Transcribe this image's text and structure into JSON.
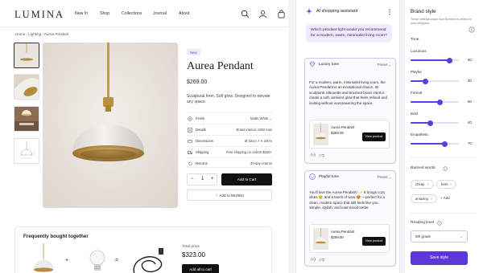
{
  "store": {
    "logo": "LUMINA",
    "nav": [
      "New In",
      "Shop",
      "Collections",
      "Journal",
      "About"
    ],
    "breadcrumb": [
      "Home",
      "Lighting",
      "Aurea Pendant"
    ],
    "badge": "New",
    "product": {
      "title": "Aurea Pendant",
      "price": "$269.00",
      "description": "Sculptural form. Soft glow. Designed to elevate any space."
    },
    "specs": [
      {
        "icon": "finish-icon",
        "label": "Finish",
        "value": "Matte White"
      },
      {
        "icon": "details-icon",
        "label": "Details",
        "value": "Brass interior, 60W max"
      },
      {
        "icon": "ruler-icon",
        "label": "Dimensions",
        "value": "Ø 32cm × H 22cm"
      },
      {
        "icon": "truck-icon",
        "label": "Shipping",
        "value": "Free shipping on orders $150+"
      },
      {
        "icon": "return-icon",
        "label": "Returns",
        "value": "30-day returns"
      }
    ],
    "quantity": "1",
    "add_to_cart": "Add to Cart",
    "wishlist": "Add to Wishlist",
    "fbt": {
      "title": "Frequently bought together",
      "plus": "+",
      "equals": "=",
      "total_label": "Total price",
      "total": "$323.00",
      "add_all": "Add all to cart"
    }
  },
  "assistant": {
    "title": "AI shopping assistant",
    "user_message": "Which pendant light would you recommend for a modern, warm, minimalist living room?",
    "cards": [
      {
        "tone": "Luxury tone",
        "preset": "Preset",
        "text": "For a modern, warm, minimalist living room, the Aurea Pendant is an exceptional choice. Its sculptural silhouette and brushed brass interior create a soft, ambient glow that feels refined and inviting without overpowering the space.",
        "product_name": "Aurea Pendant",
        "product_price": "$269.00",
        "view": "View product"
      },
      {
        "tone": "Playful tone",
        "preset": "Preset",
        "text": "You'll love the Aurea Pendant! ✨ It brings cozy vibes 😊 and a touch of wow 🤩 —perfect for a clean, modern space that still feels like you. Simple, stylish, and total mood-setter.",
        "product_name": "Aurea Pendant",
        "product_price": "$269.00",
        "view": "View product"
      }
    ]
  },
  "brand": {
    "title": "Brand style",
    "subtitle": "These settings shape how Bonkbot or writes for your shoppers.",
    "tone_label": "Tone",
    "sliders": [
      {
        "label": "Luxurious",
        "value": 80
      },
      {
        "label": "Playful",
        "value": 30
      },
      {
        "label": "Formal",
        "value": 60
      },
      {
        "label": "Bold",
        "value": 40
      },
      {
        "label": "Empathetic",
        "value": 70
      }
    ],
    "banned_label": "Banned words",
    "banned": [
      "cheap",
      "best",
      "amazing"
    ],
    "add_label": "Add",
    "reading_label": "Reading level",
    "reading_value": "8th grade",
    "save": "Save style"
  },
  "colors": {
    "accent": "#5a37d6",
    "accent_light": "#efeaff",
    "dark": "#111111"
  }
}
